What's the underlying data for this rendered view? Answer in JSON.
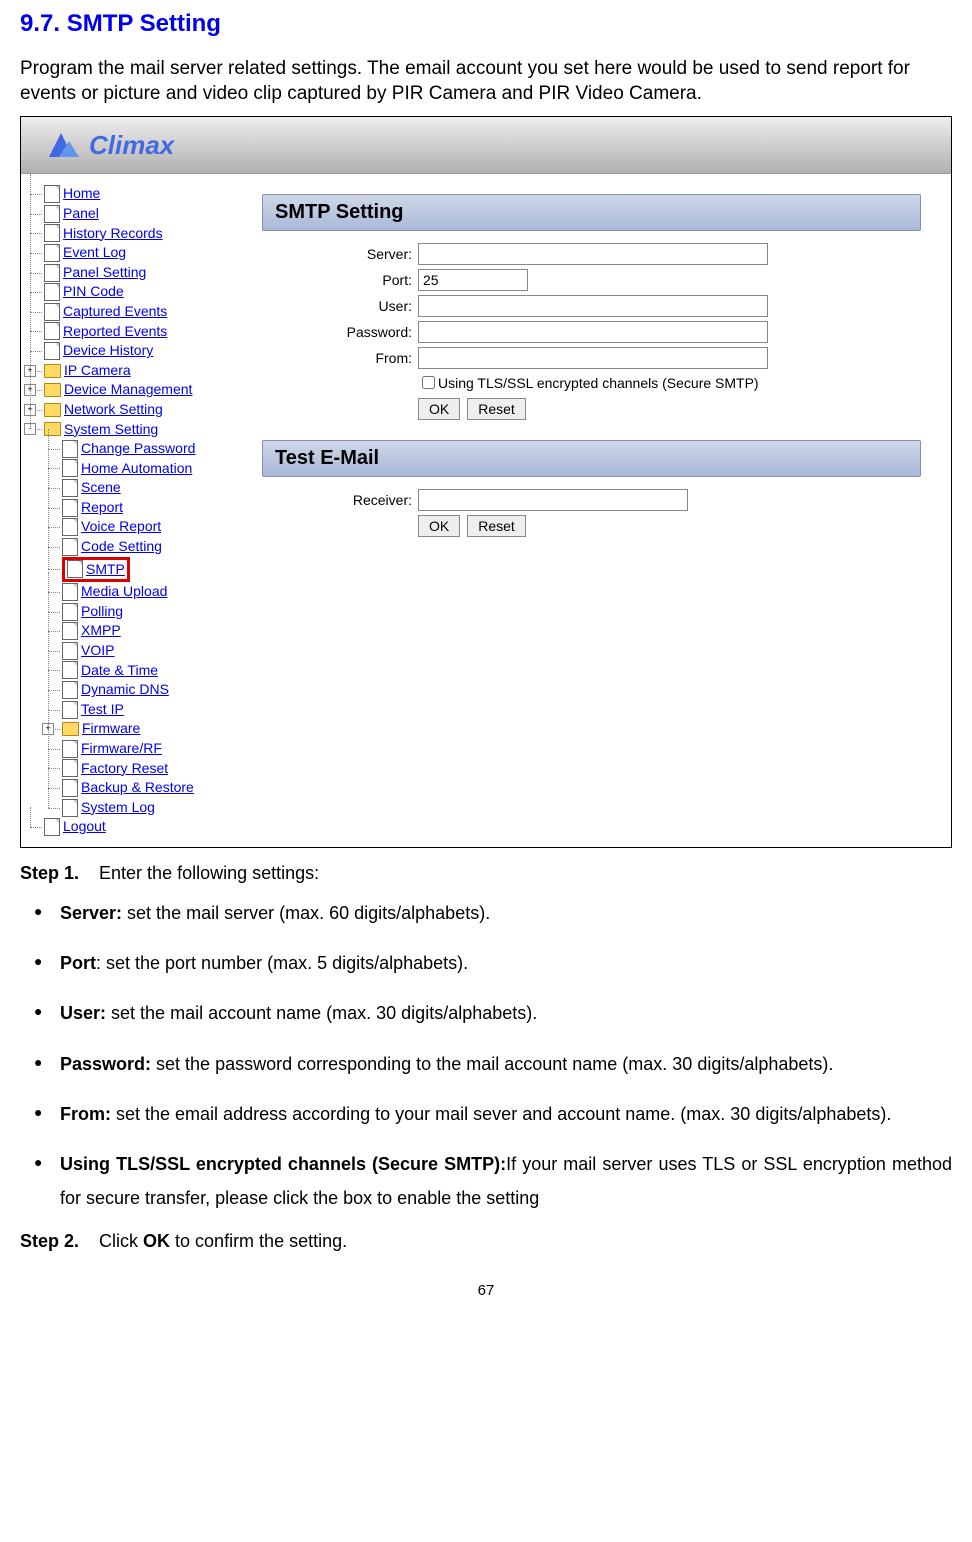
{
  "title": "9.7. SMTP Setting",
  "intro": "Program the mail server related settings. The email account you set here would be used to send report for events or picture and video clip captured by PIR Camera and PIR Video Camera.",
  "logo": "Climax",
  "nav": {
    "home": "Home",
    "panel": "Panel",
    "history_records": "History Records",
    "event_log": "Event Log",
    "panel_setting": "Panel Setting",
    "pin_code": "PIN Code",
    "captured_events": "Captured Events",
    "reported_events": "Reported Events",
    "device_history": "Device History",
    "ip_camera": "IP Camera",
    "device_management": "Device Management",
    "network_setting": "Network Setting",
    "system_setting": "System Setting",
    "change_password": "Change Password",
    "home_automation": "Home Automation",
    "scene": "Scene",
    "report": "Report",
    "voice_report": "Voice Report",
    "code_setting": "Code Setting",
    "smtp": "SMTP",
    "media_upload": "Media Upload",
    "polling": "Polling",
    "xmpp": "XMPP",
    "voip": "VOIP",
    "date_time": "Date & Time",
    "dynamic_dns": "Dynamic DNS",
    "test_ip": "Test IP",
    "firmware": "Firmware",
    "firmware_rf": "Firmware/RF",
    "factory_reset": "Factory Reset",
    "backup_restore": "Backup & Restore",
    "system_log": "System Log",
    "logout": "Logout"
  },
  "panel1": {
    "title": "SMTP Setting",
    "server_label": "Server:",
    "port_label": "Port:",
    "port_value": "25",
    "user_label": "User:",
    "password_label": "Password:",
    "from_label": "From:",
    "tls_label": " Using TLS/SSL encrypted channels (Secure SMTP)",
    "ok": "OK",
    "reset": "Reset"
  },
  "panel2": {
    "title": "Test E-Mail",
    "receiver_label": "Receiver:",
    "ok": "OK",
    "reset": "Reset"
  },
  "steps": {
    "step1_label": "Step 1.",
    "step1_text": "Enter the following settings:",
    "step2_label": "Step 2.",
    "step2_text_a": "Click ",
    "step2_text_ok": "OK",
    "step2_text_b": " to confirm the setting."
  },
  "bullets": {
    "b1_bold": "Server:",
    "b1_text": " set the mail server (max. 60 digits/alphabets).",
    "b2_bold": "Port",
    "b2_text": ": set the port number (max. 5 digits/alphabets).",
    "b3_bold": "User:",
    "b3_text": " set the mail account name (max. 30 digits/alphabets).",
    "b4_bold": "Password:",
    "b4_text": " set the password corresponding to the mail account name (max. 30 digits/alphabets).",
    "b5_bold": "From:",
    "b5_text": " set the email address according to your mail sever and account name. (max. 30 digits/alphabets).",
    "b6_bold": "Using TLS/SSL encrypted channels (Secure SMTP):",
    "b6_text": "If your mail server uses TLS or SSL encryption method for secure transfer, please click the box to enable the setting"
  },
  "page_number": "67"
}
